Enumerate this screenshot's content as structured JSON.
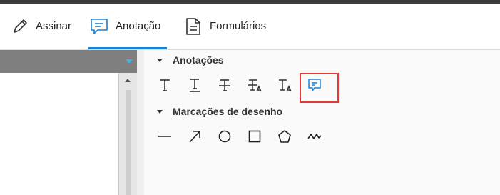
{
  "tabs": [
    {
      "label": "Assinar",
      "icon": "pen-icon"
    },
    {
      "label": "Anotação",
      "icon": "comment-icon",
      "active": true
    },
    {
      "label": "Formulários",
      "icon": "form-document-icon"
    }
  ],
  "colors": {
    "accent": "#1a82d4",
    "highlight_border": "#e53935",
    "header_gray": "#7f7f7f"
  },
  "sections": {
    "annotations": {
      "title": "Anotações",
      "tools": [
        "text-icon",
        "underline-text-icon",
        "strikethrough-text-icon",
        "replace-text-icon",
        "insert-text-icon",
        "sticky-note-icon"
      ],
      "selected_tool": "sticky-note-icon"
    },
    "drawing": {
      "title": "Marcações de desenho",
      "tools": [
        "line-icon",
        "arrow-icon",
        "circle-icon",
        "rectangle-icon",
        "pentagon-icon",
        "freehand-icon"
      ]
    }
  }
}
